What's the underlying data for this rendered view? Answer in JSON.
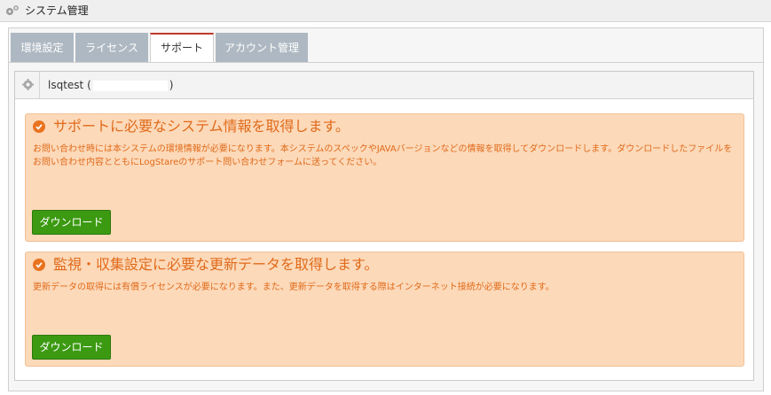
{
  "window": {
    "title": "システム管理",
    "icon": "gears-icon"
  },
  "tabs": [
    {
      "label": "環境設定",
      "active": false
    },
    {
      "label": "ライセンス",
      "active": false
    },
    {
      "label": "サポート",
      "active": true
    },
    {
      "label": "アカウント管理",
      "active": false
    }
  ],
  "server": {
    "name_prefix": "lsqtest (",
    "name_suffix": ")"
  },
  "sections": [
    {
      "heading": "サポートに必要なシステム情報を取得します。",
      "description": "お問い合わせ時には本システムの環境情報が必要になります。本システムのスペックやJAVAバージョンなどの情報を取得してダウンロードします。ダウンロードしたファイルをお問い合わせ内容とともにLogStareのサポート問い合わせフォームに送ってください。",
      "button": "ダウンロード"
    },
    {
      "heading": "監視・収集設定に必要な更新データを取得します。",
      "description": "更新データの取得には有償ライセンスが必要になります。また、更新データを取得する際はインターネット接続が必要になります。",
      "button": "ダウンロード"
    }
  ],
  "colors": {
    "accent_orange": "#e06a1a",
    "alert_bg": "#fcd9b9",
    "button_green": "#3c9a12",
    "tab_inactive": "#aeb8c2",
    "tab_active_border": "#c0392b"
  }
}
